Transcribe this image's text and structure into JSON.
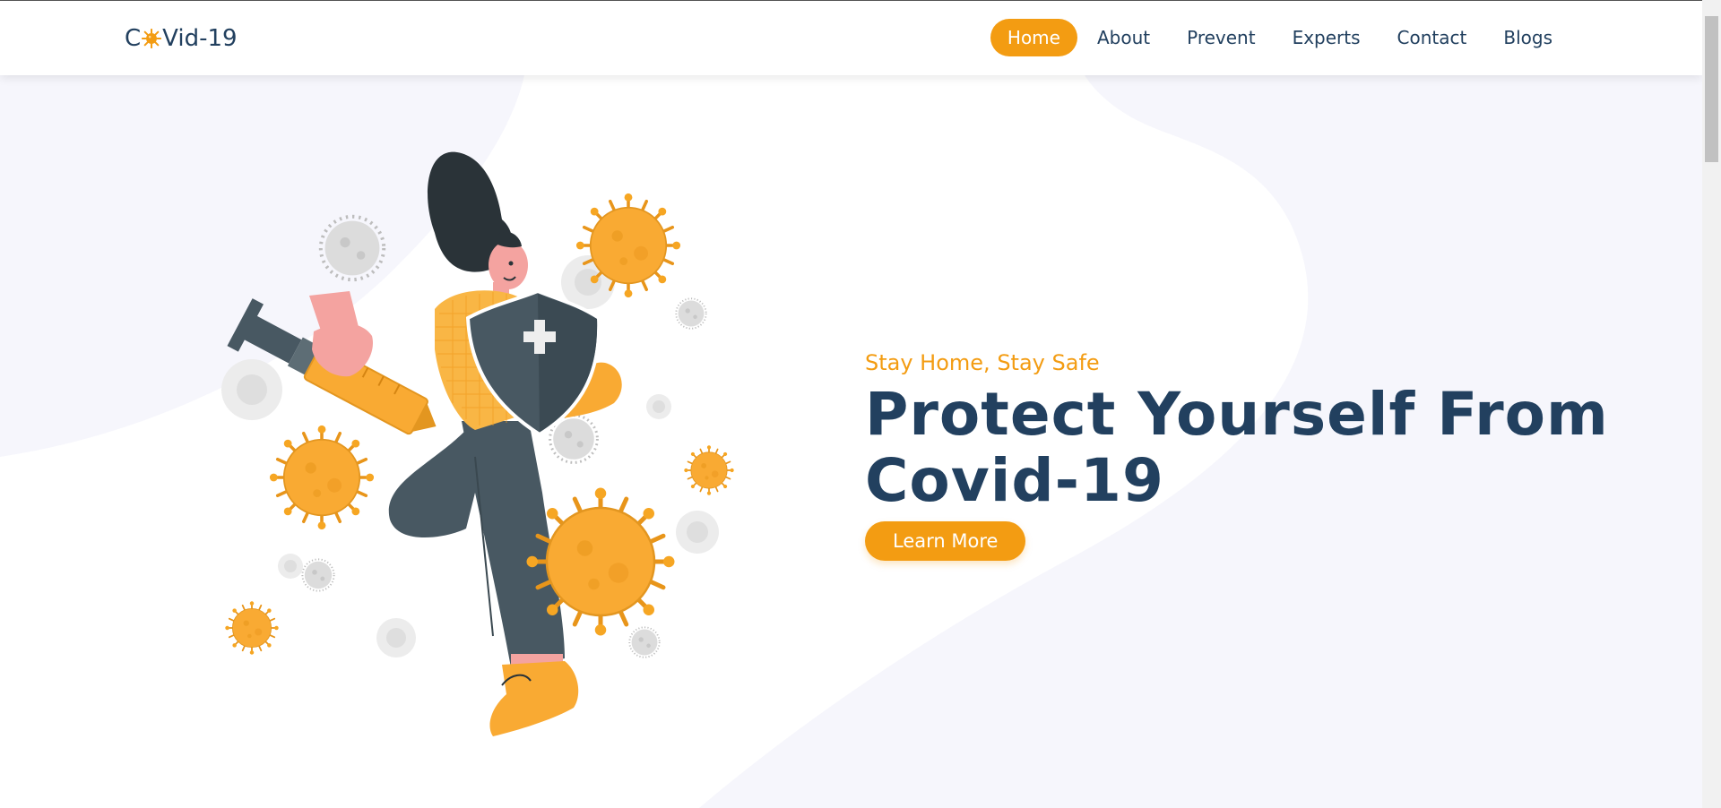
{
  "logo": {
    "prefix": "C",
    "suffix": "Vid-19",
    "accent_color": "#f39c12"
  },
  "nav": {
    "items": [
      {
        "label": "Home",
        "active": true
      },
      {
        "label": "About"
      },
      {
        "label": "Prevent"
      },
      {
        "label": "Experts"
      },
      {
        "label": "Contact"
      },
      {
        "label": "Blogs"
      }
    ]
  },
  "hero": {
    "tagline": "Stay Home, Stay Safe",
    "headline_line1": "Protect Yourself From",
    "headline_line2": "Covid-19",
    "cta_label": "Learn More"
  },
  "colors": {
    "primary": "#22405f",
    "accent": "#f39c12",
    "background_blob": "#f6f6fc"
  }
}
